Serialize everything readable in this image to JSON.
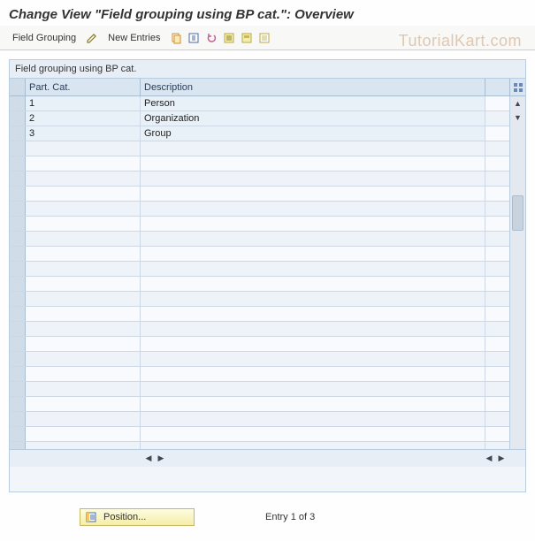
{
  "title": "Change View \"Field grouping using BP cat.\": Overview",
  "toolbar": {
    "field_grouping_label": "Field Grouping",
    "new_entries_label": "New Entries"
  },
  "watermark": "TutorialKart.com",
  "panel": {
    "title": "Field grouping using BP cat.",
    "columns": {
      "col1": "Part. Cat.",
      "col2": "Description"
    },
    "rows": [
      {
        "cat": "1",
        "desc": "Person"
      },
      {
        "cat": "2",
        "desc": "Organization"
      },
      {
        "cat": "3",
        "desc": "Group"
      }
    ]
  },
  "footer": {
    "position_label": "Position...",
    "entry_status": "Entry 1 of 3"
  }
}
